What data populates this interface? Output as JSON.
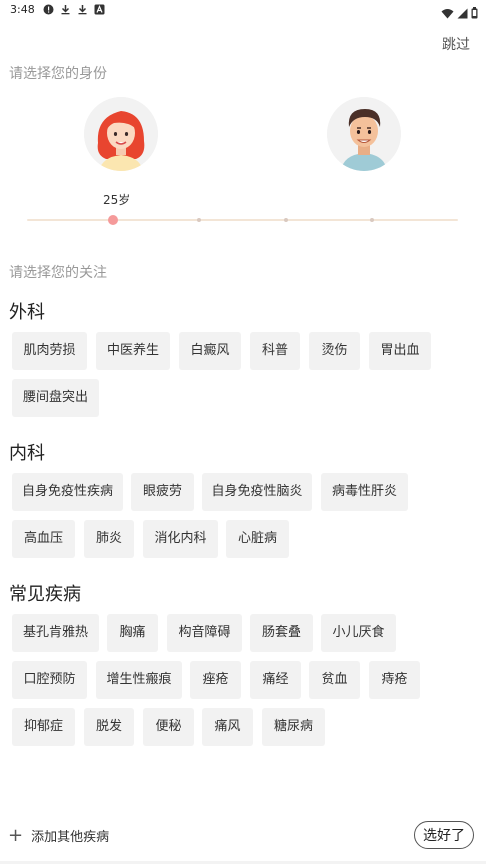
{
  "status_bar": {
    "time": "3:48",
    "left_icons": [
      "alert-icon",
      "download-icon",
      "download-icon",
      "text-a-icon"
    ],
    "right_icons": [
      "wifi-icon",
      "signal-icon",
      "battery-icon"
    ]
  },
  "header": {
    "skip_label": "跳过"
  },
  "identity": {
    "prompt": "请选择您的身份",
    "options": [
      "female-avatar",
      "male-avatar"
    ],
    "age_label": "25岁",
    "age_slider_value_fraction": 0.2,
    "age_slider_steps": 5
  },
  "focus": {
    "prompt": "请选择您的关注",
    "categories": [
      {
        "title": "外科",
        "tags": [
          "肌肉劳损",
          "中医养生",
          "白癜风",
          "科普",
          "烫伤",
          "胃出血",
          "腰间盘突出"
        ]
      },
      {
        "title": "内科",
        "tags": [
          "自身免疫性疾病",
          "眼疲劳",
          "自身免疫性脑炎",
          "病毒性肝炎",
          "高血压",
          "肺炎",
          "消化内科",
          "心脏病"
        ]
      },
      {
        "title": "常见疾病",
        "tags": [
          "基孔肯雅热",
          "胸痛",
          "构音障碍",
          "肠套叠",
          "小儿厌食",
          "口腔预防",
          "增生性瘢痕",
          "痤疮",
          "痛经",
          "贫血",
          "痔疮",
          "抑郁症",
          "脱发",
          "便秘",
          "痛风",
          "糖尿病"
        ]
      }
    ]
  },
  "footer": {
    "add_label": "添加其他疾病",
    "done_label": "选好了"
  },
  "colors": {
    "accent": "#f59a9a",
    "tag_bg": "#f2f2f2",
    "track": "#f3e5d6"
  }
}
